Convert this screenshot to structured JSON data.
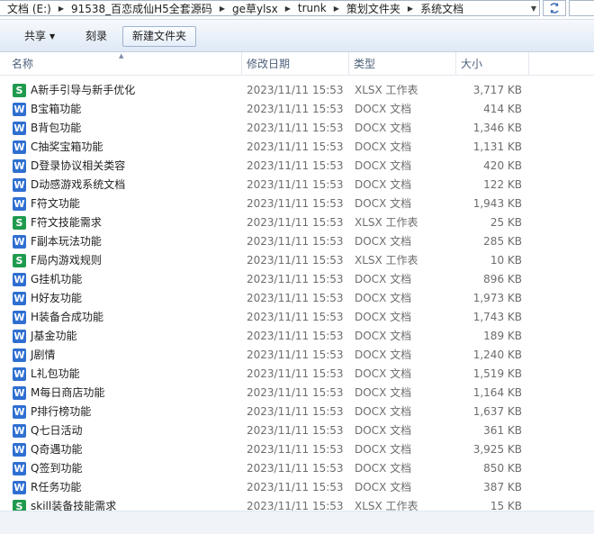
{
  "breadcrumb": [
    "文档 (E:)",
    "91538_百恋成仙H5全套源码",
    "ge草ylsx",
    "trunk",
    "策划文件夹",
    "系统文档"
  ],
  "toolbar": {
    "share": "共享",
    "burn": "刻录",
    "new_folder": "新建文件夹"
  },
  "columns": {
    "name": "名称",
    "modified": "修改日期",
    "type": "类型",
    "size": "大小"
  },
  "icons": {
    "docx": "W",
    "xlsx": "S",
    "docx_color": "#2f6fd1",
    "xlsx_color": "#1f9a4e"
  },
  "files": [
    {
      "name": "A新手引导与新手优化",
      "kind": "xlsx",
      "date": "2023/11/11 15:53",
      "type": "XLSX 工作表",
      "size": "3,717 KB"
    },
    {
      "name": "B宝箱功能",
      "kind": "docx",
      "date": "2023/11/11 15:53",
      "type": "DOCX 文档",
      "size": "414 KB"
    },
    {
      "name": "B背包功能",
      "kind": "docx",
      "date": "2023/11/11 15:53",
      "type": "DOCX 文档",
      "size": "1,346 KB"
    },
    {
      "name": "C抽奖宝箱功能",
      "kind": "docx",
      "date": "2023/11/11 15:53",
      "type": "DOCX 文档",
      "size": "1,131 KB"
    },
    {
      "name": "D登录协议相关类容",
      "kind": "docx",
      "date": "2023/11/11 15:53",
      "type": "DOCX 文档",
      "size": "420 KB"
    },
    {
      "name": "D动感游戏系统文档",
      "kind": "docx",
      "date": "2023/11/11 15:53",
      "type": "DOCX 文档",
      "size": "122 KB"
    },
    {
      "name": "F符文功能",
      "kind": "docx",
      "date": "2023/11/11 15:53",
      "type": "DOCX 文档",
      "size": "1,943 KB"
    },
    {
      "name": "F符文技能需求",
      "kind": "xlsx",
      "date": "2023/11/11 15:53",
      "type": "XLSX 工作表",
      "size": "25 KB"
    },
    {
      "name": "F副本玩法功能",
      "kind": "docx",
      "date": "2023/11/11 15:53",
      "type": "DOCX 文档",
      "size": "285 KB"
    },
    {
      "name": "F局内游戏规则",
      "kind": "xlsx",
      "date": "2023/11/11 15:53",
      "type": "XLSX 工作表",
      "size": "10 KB"
    },
    {
      "name": "G挂机功能",
      "kind": "docx",
      "date": "2023/11/11 15:53",
      "type": "DOCX 文档",
      "size": "896 KB"
    },
    {
      "name": "H好友功能",
      "kind": "docx",
      "date": "2023/11/11 15:53",
      "type": "DOCX 文档",
      "size": "1,973 KB"
    },
    {
      "name": "H装备合成功能",
      "kind": "docx",
      "date": "2023/11/11 15:53",
      "type": "DOCX 文档",
      "size": "1,743 KB"
    },
    {
      "name": "J基金功能",
      "kind": "docx",
      "date": "2023/11/11 15:53",
      "type": "DOCX 文档",
      "size": "189 KB"
    },
    {
      "name": "J剧情",
      "kind": "docx",
      "date": "2023/11/11 15:53",
      "type": "DOCX 文档",
      "size": "1,240 KB"
    },
    {
      "name": "L礼包功能",
      "kind": "docx",
      "date": "2023/11/11 15:53",
      "type": "DOCX 文档",
      "size": "1,519 KB"
    },
    {
      "name": "M每日商店功能",
      "kind": "docx",
      "date": "2023/11/11 15:53",
      "type": "DOCX 文档",
      "size": "1,164 KB"
    },
    {
      "name": "P排行榜功能",
      "kind": "docx",
      "date": "2023/11/11 15:53",
      "type": "DOCX 文档",
      "size": "1,637 KB"
    },
    {
      "name": "Q七日活动",
      "kind": "docx",
      "date": "2023/11/11 15:53",
      "type": "DOCX 文档",
      "size": "361 KB"
    },
    {
      "name": "Q奇遇功能",
      "kind": "docx",
      "date": "2023/11/11 15:53",
      "type": "DOCX 文档",
      "size": "3,925 KB"
    },
    {
      "name": "Q签到功能",
      "kind": "docx",
      "date": "2023/11/11 15:53",
      "type": "DOCX 文档",
      "size": "850 KB"
    },
    {
      "name": "R任务功能",
      "kind": "docx",
      "date": "2023/11/11 15:53",
      "type": "DOCX 文档",
      "size": "387 KB"
    },
    {
      "name": "skill装备技能需求",
      "kind": "xlsx",
      "date": "2023/11/11 15:53",
      "type": "XLSX 工作表",
      "size": "15 KB"
    }
  ]
}
